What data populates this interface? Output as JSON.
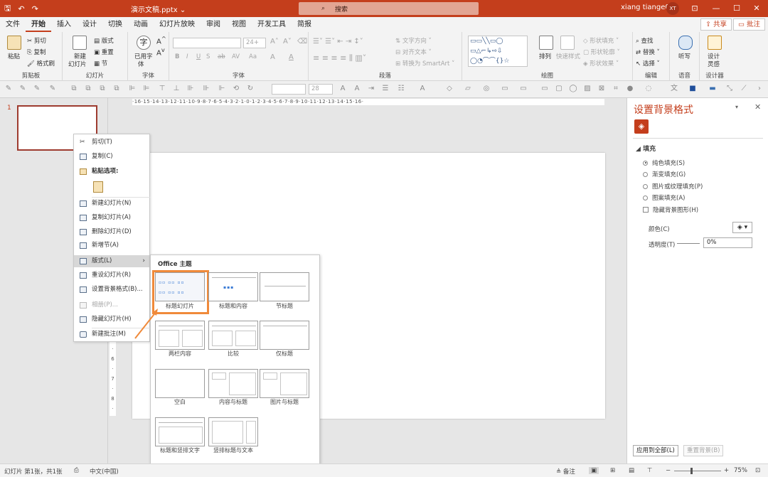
{
  "titlebar": {
    "doc_title": "演示文稿.pptx ⌄",
    "search_placeholder": "搜索",
    "user_name": "xiang tiange02",
    "avatar_initials": "XT",
    "accent_color": "#c43e1c"
  },
  "menu": {
    "tabs": [
      "文件",
      "开始",
      "插入",
      "设计",
      "切换",
      "动画",
      "幻灯片放映",
      "审阅",
      "视图",
      "开发工具",
      "简报"
    ],
    "active_tab": "开始",
    "share_label": "共享",
    "comment_label": "批注"
  },
  "ribbon": {
    "groups": {
      "clipboard": "剪贴板",
      "slides": "幻灯片",
      "font_icon": "字体",
      "font": "字体",
      "paragraph": "段落",
      "drawing": "绘图",
      "editing": "编辑",
      "voice": "语音",
      "designer": "设计器"
    },
    "clipboard": {
      "paste": "粘贴",
      "cut": "剪切",
      "copy": "复制",
      "format_painter": "格式刷"
    },
    "slides": {
      "new_slide_1": "新建",
      "new_slide_2": "幻灯片",
      "layout": "版式",
      "reset": "重置",
      "section": "节"
    },
    "font_icon": {
      "label_1": "已用字",
      "label_2": "体"
    },
    "font": {
      "size": "24+",
      "bold": "B",
      "italic": "I",
      "underline": "U",
      "strike": "S",
      "shadow": "ab",
      "spacing": "AV",
      "case": "Aa",
      "clear": "A",
      "color": "A"
    },
    "paragraph": {
      "text_dir": "文字方向",
      "align_text": "对齐文本",
      "smartart": "转换为 SmartArt"
    },
    "drawing": {
      "arrange": "排列",
      "quick_styles": "快速样式",
      "fill": "形状填充",
      "outline": "形状轮廓",
      "effects": "形状效果"
    },
    "editing": {
      "find": "查找",
      "replace": "替换",
      "select": "选择"
    },
    "voice": {
      "dictate": "听写"
    },
    "designer": {
      "label_1": "设计",
      "label_2": "灵感"
    },
    "drawbar": {
      "font_size": "28"
    }
  },
  "thumbnails": {
    "slide_number": "1"
  },
  "ruler": {
    "top_text": "·16·15·14·13·12·11·10·9·8·7·6·5·4·3·2·1·0·1·2·3·4·5·6·7·8·9·10·11·12·13·14·15·16·",
    "left_ticks": [
      "5",
      "·",
      "6",
      "·",
      "7",
      "·",
      "8",
      "·",
      "9"
    ]
  },
  "context_menu": {
    "cut": "剪切(T)",
    "copy": "复制(C)",
    "paste_options": "粘贴选项:",
    "new_slide": "新建幻灯片(N)",
    "duplicate_slide": "复制幻灯片(A)",
    "delete_slide": "删除幻灯片(D)",
    "new_section": "新增节(A)",
    "layout": "版式(L)",
    "reset_slide": "重设幻灯片(R)",
    "format_background": "设置背景格式(B)...",
    "photo_album": "相册(P)...",
    "hide_slide": "隐藏幻灯片(H)",
    "new_comment": "新建批注(M)"
  },
  "layout_menu": {
    "header": "Office 主题",
    "items": [
      "标题幻灯片",
      "标题和内容",
      "节标题",
      "两栏内容",
      "比较",
      "仅标题",
      "空白",
      "内容与标题",
      "图片与标题",
      "标题和竖排文字",
      "竖排标题与文本"
    ],
    "selected": "标题幻灯片",
    "highlight_color": "#f08a3a"
  },
  "pane": {
    "title": "设置背景格式",
    "fill_header": "填充",
    "options": [
      "纯色填充(S)",
      "渐变填充(G)",
      "图片或纹理填充(P)",
      "图案填充(A)"
    ],
    "selected_option": "纯色填充(S)",
    "hide_bg_graphics": "隐藏背景图形(H)",
    "color_label": "颜色(C)",
    "transparency_label": "透明度(T)",
    "transparency_value": "0%",
    "apply_all": "应用到全部(L)",
    "reset_bg": "重置背景(B)"
  },
  "status": {
    "slide_info": "幻灯片 第1张，共1张",
    "language": "中文(中国)",
    "notes": "备注",
    "zoom": "75%"
  }
}
